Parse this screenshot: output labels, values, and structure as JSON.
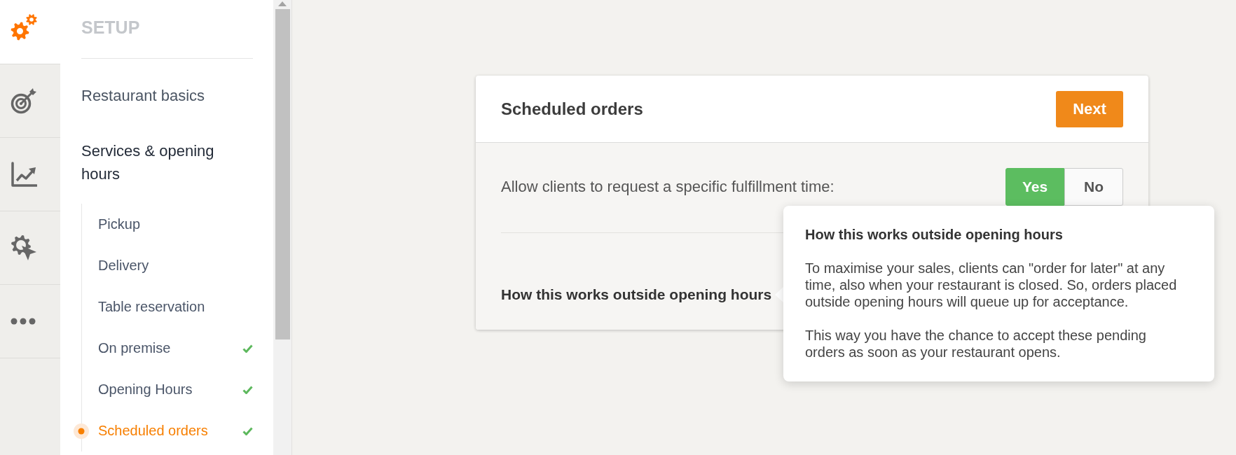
{
  "rail": [
    {
      "selected": true
    },
    {
      "selected": false
    },
    {
      "selected": false
    },
    {
      "selected": false
    },
    {
      "selected": false
    }
  ],
  "sidebar": {
    "heading": "SETUP",
    "items": [
      {
        "label": "Restaurant basics",
        "expanded": false
      },
      {
        "label": "Services & opening hours",
        "expanded": true,
        "children": [
          {
            "label": "Pickup",
            "completed": false,
            "selected": false
          },
          {
            "label": "Delivery",
            "completed": false,
            "selected": false
          },
          {
            "label": "Table reservation",
            "completed": false,
            "selected": false
          },
          {
            "label": "On premise",
            "completed": true,
            "selected": false
          },
          {
            "label": "Opening Hours",
            "completed": true,
            "selected": false
          },
          {
            "label": "Scheduled orders",
            "completed": true,
            "selected": true
          }
        ]
      }
    ]
  },
  "card": {
    "title": "Scheduled orders",
    "next_button": "Next",
    "question": "Allow clients to request a specific fulfillment time:",
    "options": [
      {
        "label": "Yes",
        "selected": true
      },
      {
        "label": "No",
        "selected": false
      }
    ],
    "help_link": "How this works outside opening hours"
  },
  "tooltip": {
    "title": "How this works outside opening hours",
    "paragraphs": [
      "To maximise your sales, clients can \"order for later\" at any time, also when your restaurant is closed. So, orders placed outside opening hours will queue up for acceptance.",
      "This way you have the chance to accept these pending orders as soon as your restaurant opens."
    ]
  }
}
